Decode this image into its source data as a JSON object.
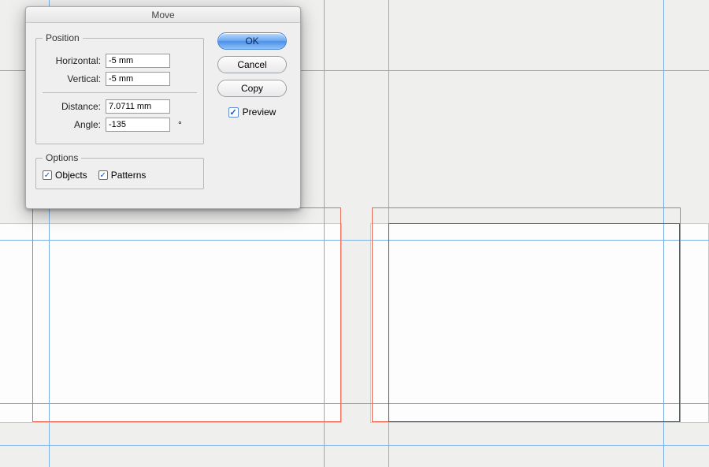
{
  "dialog": {
    "title": "Move",
    "position": {
      "legend": "Position",
      "horizontal_label": "Horizontal:",
      "horizontal_value": "-5 mm",
      "vertical_label": "Vertical:",
      "vertical_value": "-5 mm",
      "distance_label": "Distance:",
      "distance_value": "7.0711 mm",
      "angle_label": "Angle:",
      "angle_value": "-135",
      "angle_suffix": "°"
    },
    "options": {
      "legend": "Options",
      "objects_label": "Objects",
      "objects_checked": true,
      "patterns_label": "Patterns",
      "patterns_checked": true
    },
    "buttons": {
      "ok": "OK",
      "cancel": "Cancel",
      "copy": "Copy"
    },
    "preview": {
      "label": "Preview",
      "checked": true
    }
  }
}
